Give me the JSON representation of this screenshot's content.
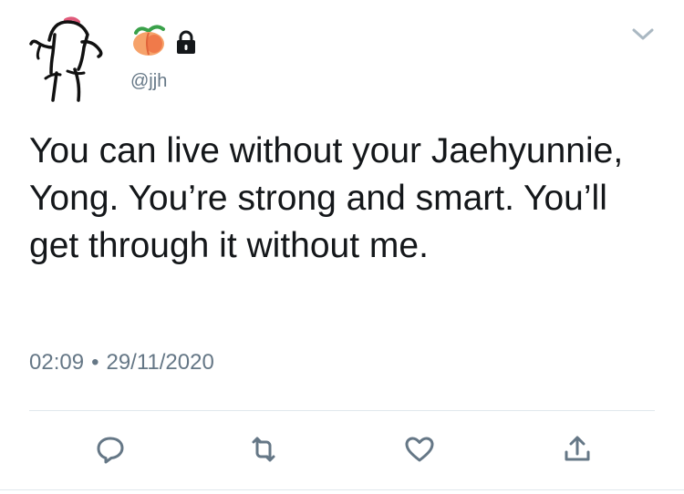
{
  "tweet": {
    "avatar_icon": "stick-figure-avatar",
    "name_icons": [
      "peach-emoji",
      "lock-icon"
    ],
    "handle": "@jjh",
    "text": "You can live without your Jaehyunnie, Yong. You’re strong and smart. You’ll get through it without me.",
    "time": "02:09",
    "separator": "•",
    "date": "29/11/2020"
  },
  "actions": [
    {
      "name": "reply",
      "icon": "reply-icon"
    },
    {
      "name": "retweet",
      "icon": "retweet-icon"
    },
    {
      "name": "like",
      "icon": "heart-icon"
    },
    {
      "name": "share",
      "icon": "share-icon"
    }
  ],
  "colors": {
    "text": "#14171a",
    "secondary": "#657786",
    "accent": "#1da1f2",
    "divider": "#e1e8ed",
    "chevron": "#aab8c2"
  }
}
